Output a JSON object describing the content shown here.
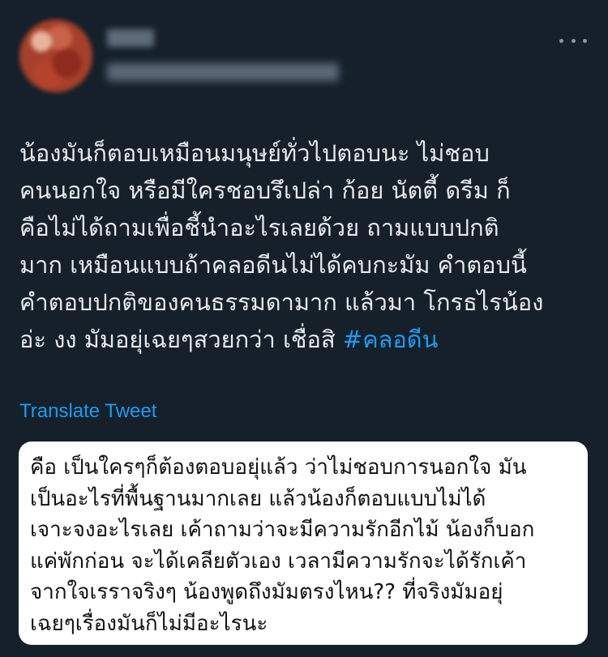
{
  "tweet": {
    "author": {
      "name": "",
      "handle": "",
      "avatar_blurred": true
    },
    "more_icon": "more-horizontal-icon",
    "text_lines": [
      "น้องมันก็ตอบเหมือนมนุษย์ทั่วไปตอบนะ ไม่ชอบ",
      "คนนอกใจ หรือมีใครชอบรึเปล่า ก้อย นัตตี้ ดรีม ก็",
      "คือไม่ได้ถามเพื่อชี้นำอะไรเลยด้วย ถามแบบปกติ",
      "มาก เหมือนแบบถ้าคลอดีนไม่ได้คบกะมัม คำตอบนี้",
      "คำตอบปกติของคนธรรมดามาก แล้วมา โกรธไรน้อง",
      "อ่ะ งง มัมอยุ่เฉยๆสวยกว่า เชื่อสิ "
    ],
    "hashtag": "#คลอดีน",
    "translate_label": "Translate Tweet",
    "hashtag_color": "#1d9bf0",
    "background_color": "#15202b"
  },
  "quote": {
    "lines": [
      "คือ เป็นใครๆก็ต้องตอบอยุ่แล้ว ว่าไม่ชอบการนอกใจ มัน",
      "เป็นอะไรที่พื้นฐานมากเลย แล้วน้องก็ตอบแบบไม่ได้",
      "เจาะจงอะไรเลย เค้าถามว่าจะมีความรักอีกไม้ น้องก็บอก",
      "แค่พักก่อน จะได้เคลียตัวเอง เวลามีความรักจะได้รักเค้า",
      "จากใจเรราจริงๆ น้องพูดถึงมัมตรงไหน?? ที่จริงมัมอยุ่",
      "เฉยๆเรื่องมันก็ไม่มีอะไรนะ"
    ]
  }
}
